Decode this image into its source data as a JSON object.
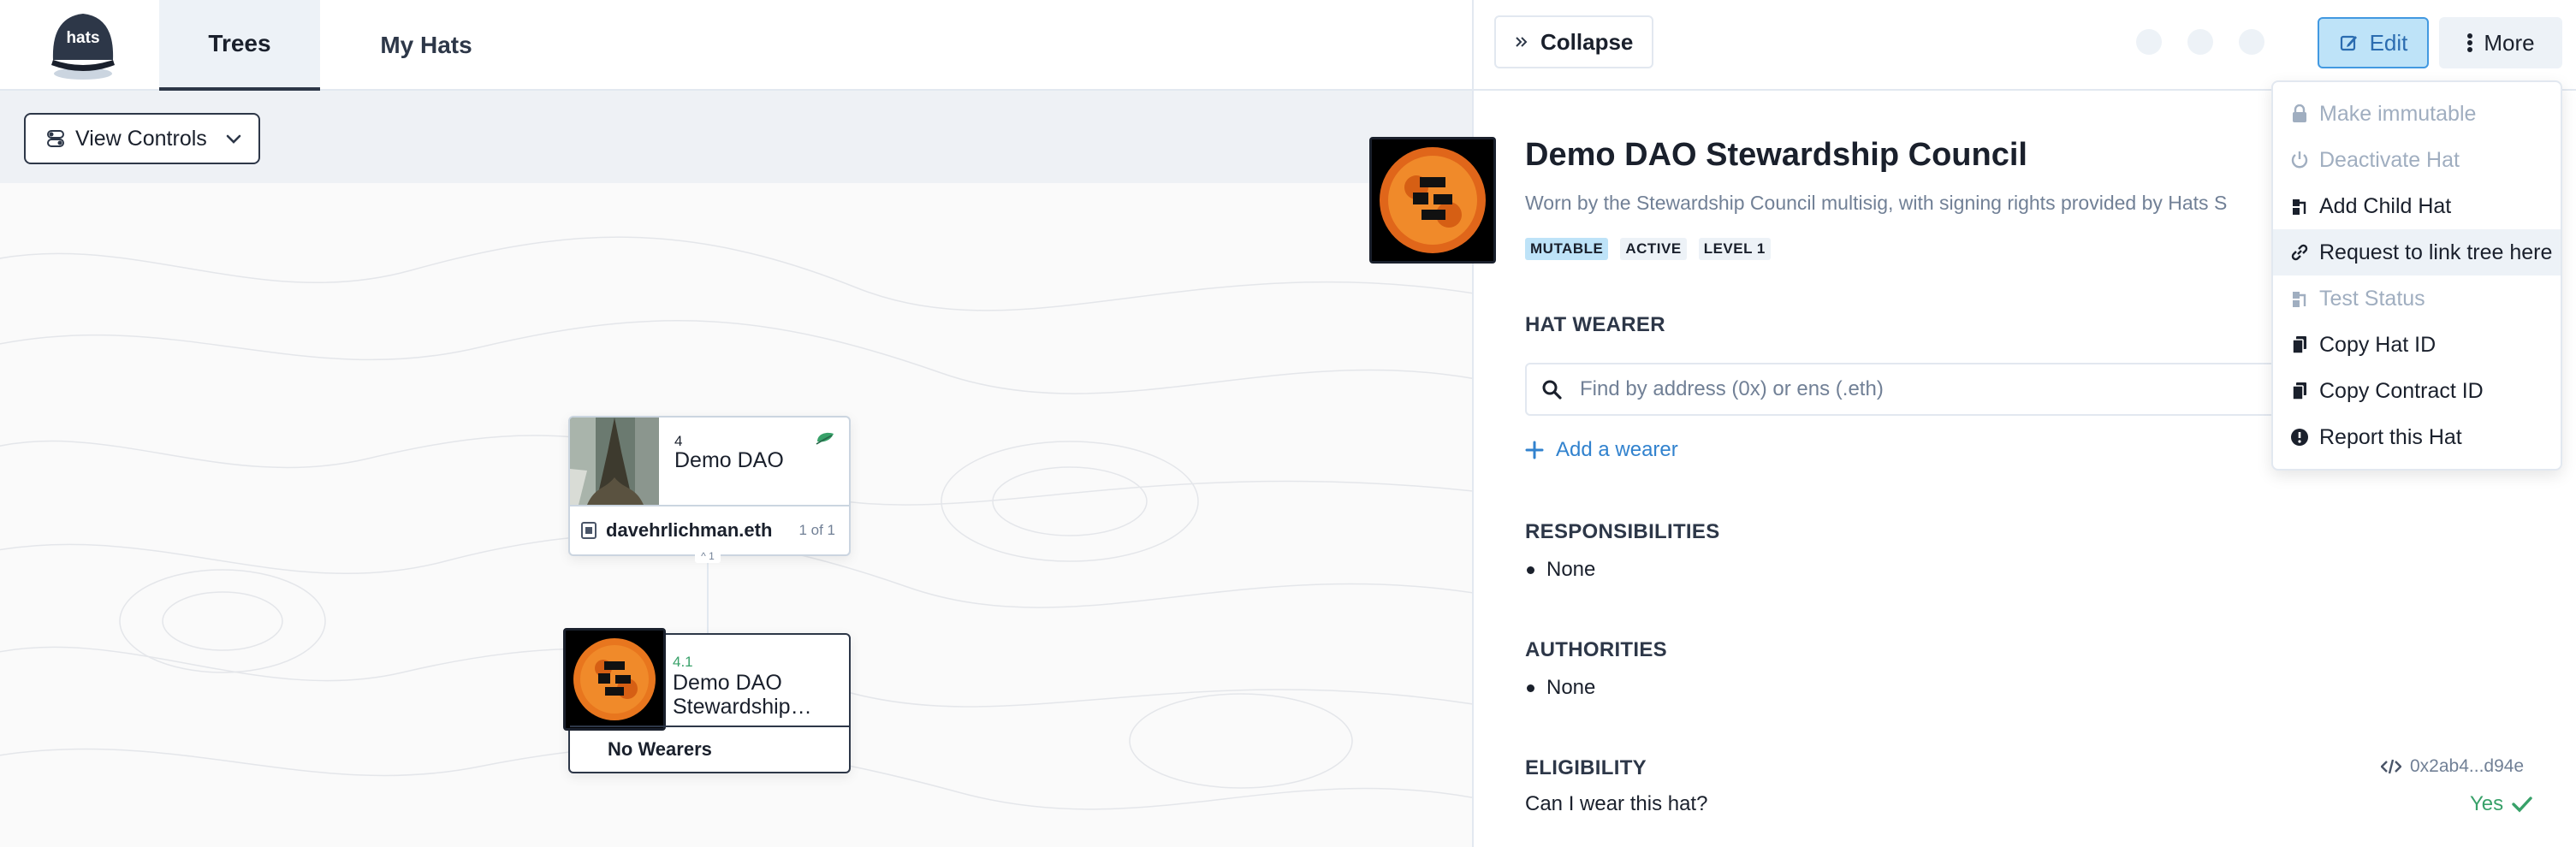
{
  "header": {
    "logo_text": "hats",
    "tabs": [
      {
        "label": "Trees",
        "active": true
      },
      {
        "label": "My Hats",
        "active": false
      }
    ]
  },
  "canvas": {
    "view_controls_label": "View Controls",
    "tree": {
      "root": {
        "id": "4",
        "name": "Demo DAO",
        "wearer": "davehrlichman.eth",
        "count": "1 of 1"
      },
      "child": {
        "id": "4.1",
        "name": "Demo DAO Stewardship…",
        "wearers": "No Wearers"
      },
      "collapse_toggle": "^ 1"
    }
  },
  "panel": {
    "collapse_label": "Collapse",
    "edit_label": "Edit",
    "more_label": "More",
    "hat": {
      "title": "Demo DAO Stewardship Council",
      "description": "Worn by the Stewardship Council multisig, with signing rights provided by Hats S",
      "badges": [
        "MUTABLE",
        "ACTIVE",
        "LEVEL 1"
      ]
    },
    "wearer_section": {
      "title": "HAT WEARER",
      "search_placeholder": "Find by address (0x) or ens (.eth)",
      "add_label": "Add a wearer"
    },
    "responsibilities": {
      "title": "RESPONSIBILITIES",
      "items": [
        "None"
      ]
    },
    "authorities": {
      "title": "AUTHORITIES",
      "items": [
        "None"
      ]
    },
    "eligibility": {
      "title": "ELIGIBILITY",
      "address": "0x2ab4...d94e",
      "question": "Can I wear this hat?",
      "answer": "Yes"
    }
  },
  "menu": {
    "items": [
      {
        "label": "Make immutable",
        "icon": "lock-icon",
        "disabled": true
      },
      {
        "label": "Deactivate Hat",
        "icon": "power-icon",
        "disabled": true
      },
      {
        "label": "Add Child Hat",
        "icon": "child-hat-icon",
        "disabled": false
      },
      {
        "label": "Request to link tree here",
        "icon": "link-icon",
        "disabled": false
      },
      {
        "label": "Test Status",
        "icon": "test-status-icon",
        "disabled": true
      },
      {
        "label": "Copy Hat ID",
        "icon": "copy-icon",
        "disabled": false
      },
      {
        "label": "Copy Contract ID",
        "icon": "copy-icon",
        "disabled": false
      },
      {
        "label": "Report this Hat",
        "icon": "alert-icon",
        "disabled": false
      }
    ]
  },
  "colors": {
    "accent": "#3182ce",
    "edit_bg": "#bee3f8",
    "success": "#38a169",
    "text": "#1a202c",
    "muted": "#718096"
  }
}
